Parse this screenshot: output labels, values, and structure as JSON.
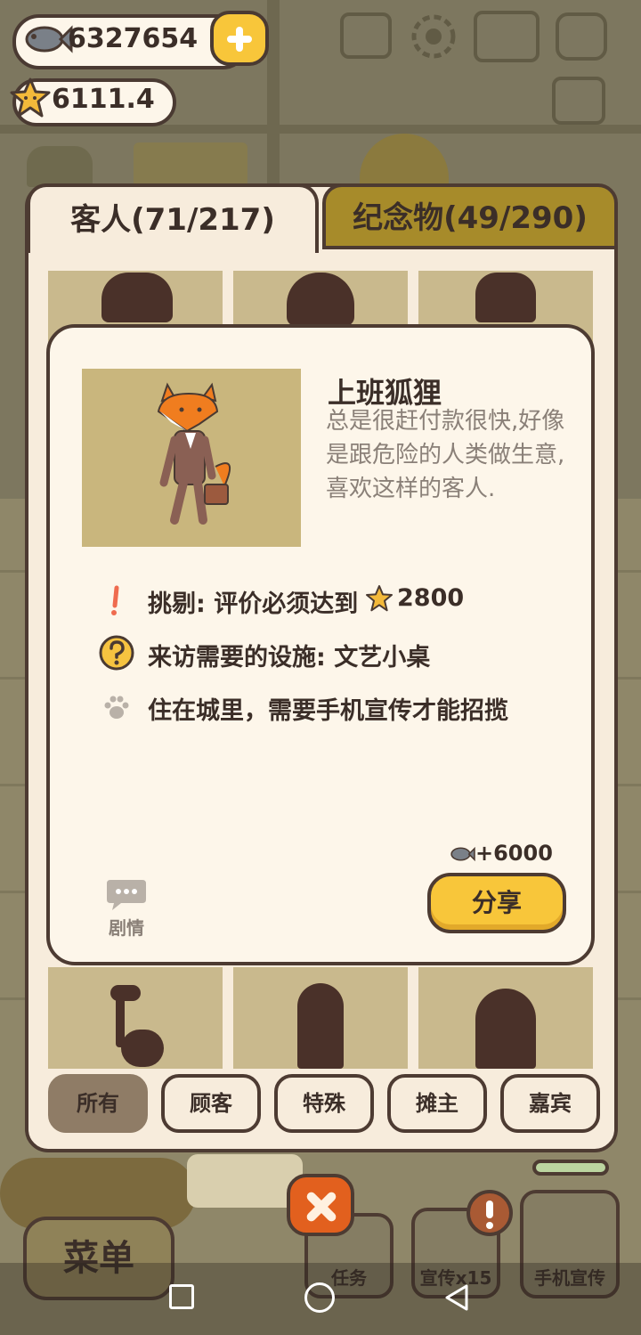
{
  "hud": {
    "fish_count": "6327654",
    "star_count": "6111.4",
    "plus_icon": "plus-icon",
    "top_icons": [
      "podium-icon",
      "gear-icon",
      "book-icon",
      "camera-icon",
      "newspaper-icon"
    ]
  },
  "tabs": {
    "guests": "客人(71/217)",
    "souvenirs": "纪念物(49/290)"
  },
  "grid": {
    "ellipsis": "..."
  },
  "modal": {
    "name": "上班狐狸",
    "description": "总是很赶付款很快,好像是跟危险的人类做生意,喜欢这样的客人.",
    "requirements": [
      {
        "icon": "exclamation-icon",
        "prefix": "挑剔: 评价必须达到",
        "inline_icon": "star-icon",
        "value": "2800"
      },
      {
        "icon": "question-icon",
        "text": "来访需要的设施: 文艺小桌"
      },
      {
        "icon": "paw-icon",
        "text": "住在城里，需要手机宣传才能招揽"
      }
    ],
    "reward": "+6000",
    "share_label": "分享",
    "story_label": "剧情"
  },
  "filters": [
    {
      "label": "所有",
      "active": true
    },
    {
      "label": "顾客",
      "active": false
    },
    {
      "label": "特殊",
      "active": false
    },
    {
      "label": "摊主",
      "active": false
    },
    {
      "label": "嘉宾",
      "active": false
    }
  ],
  "bottom": {
    "menu_label": "菜单",
    "task_label": "任务",
    "promo_label": "宣传x15",
    "phone_promo_label": "手机宣传"
  },
  "colors": {
    "accent_yellow": "#f8c63a",
    "outline_brown": "#4d3b32",
    "panel_cream": "#fdf6ea",
    "close_orange": "#e2601e"
  }
}
